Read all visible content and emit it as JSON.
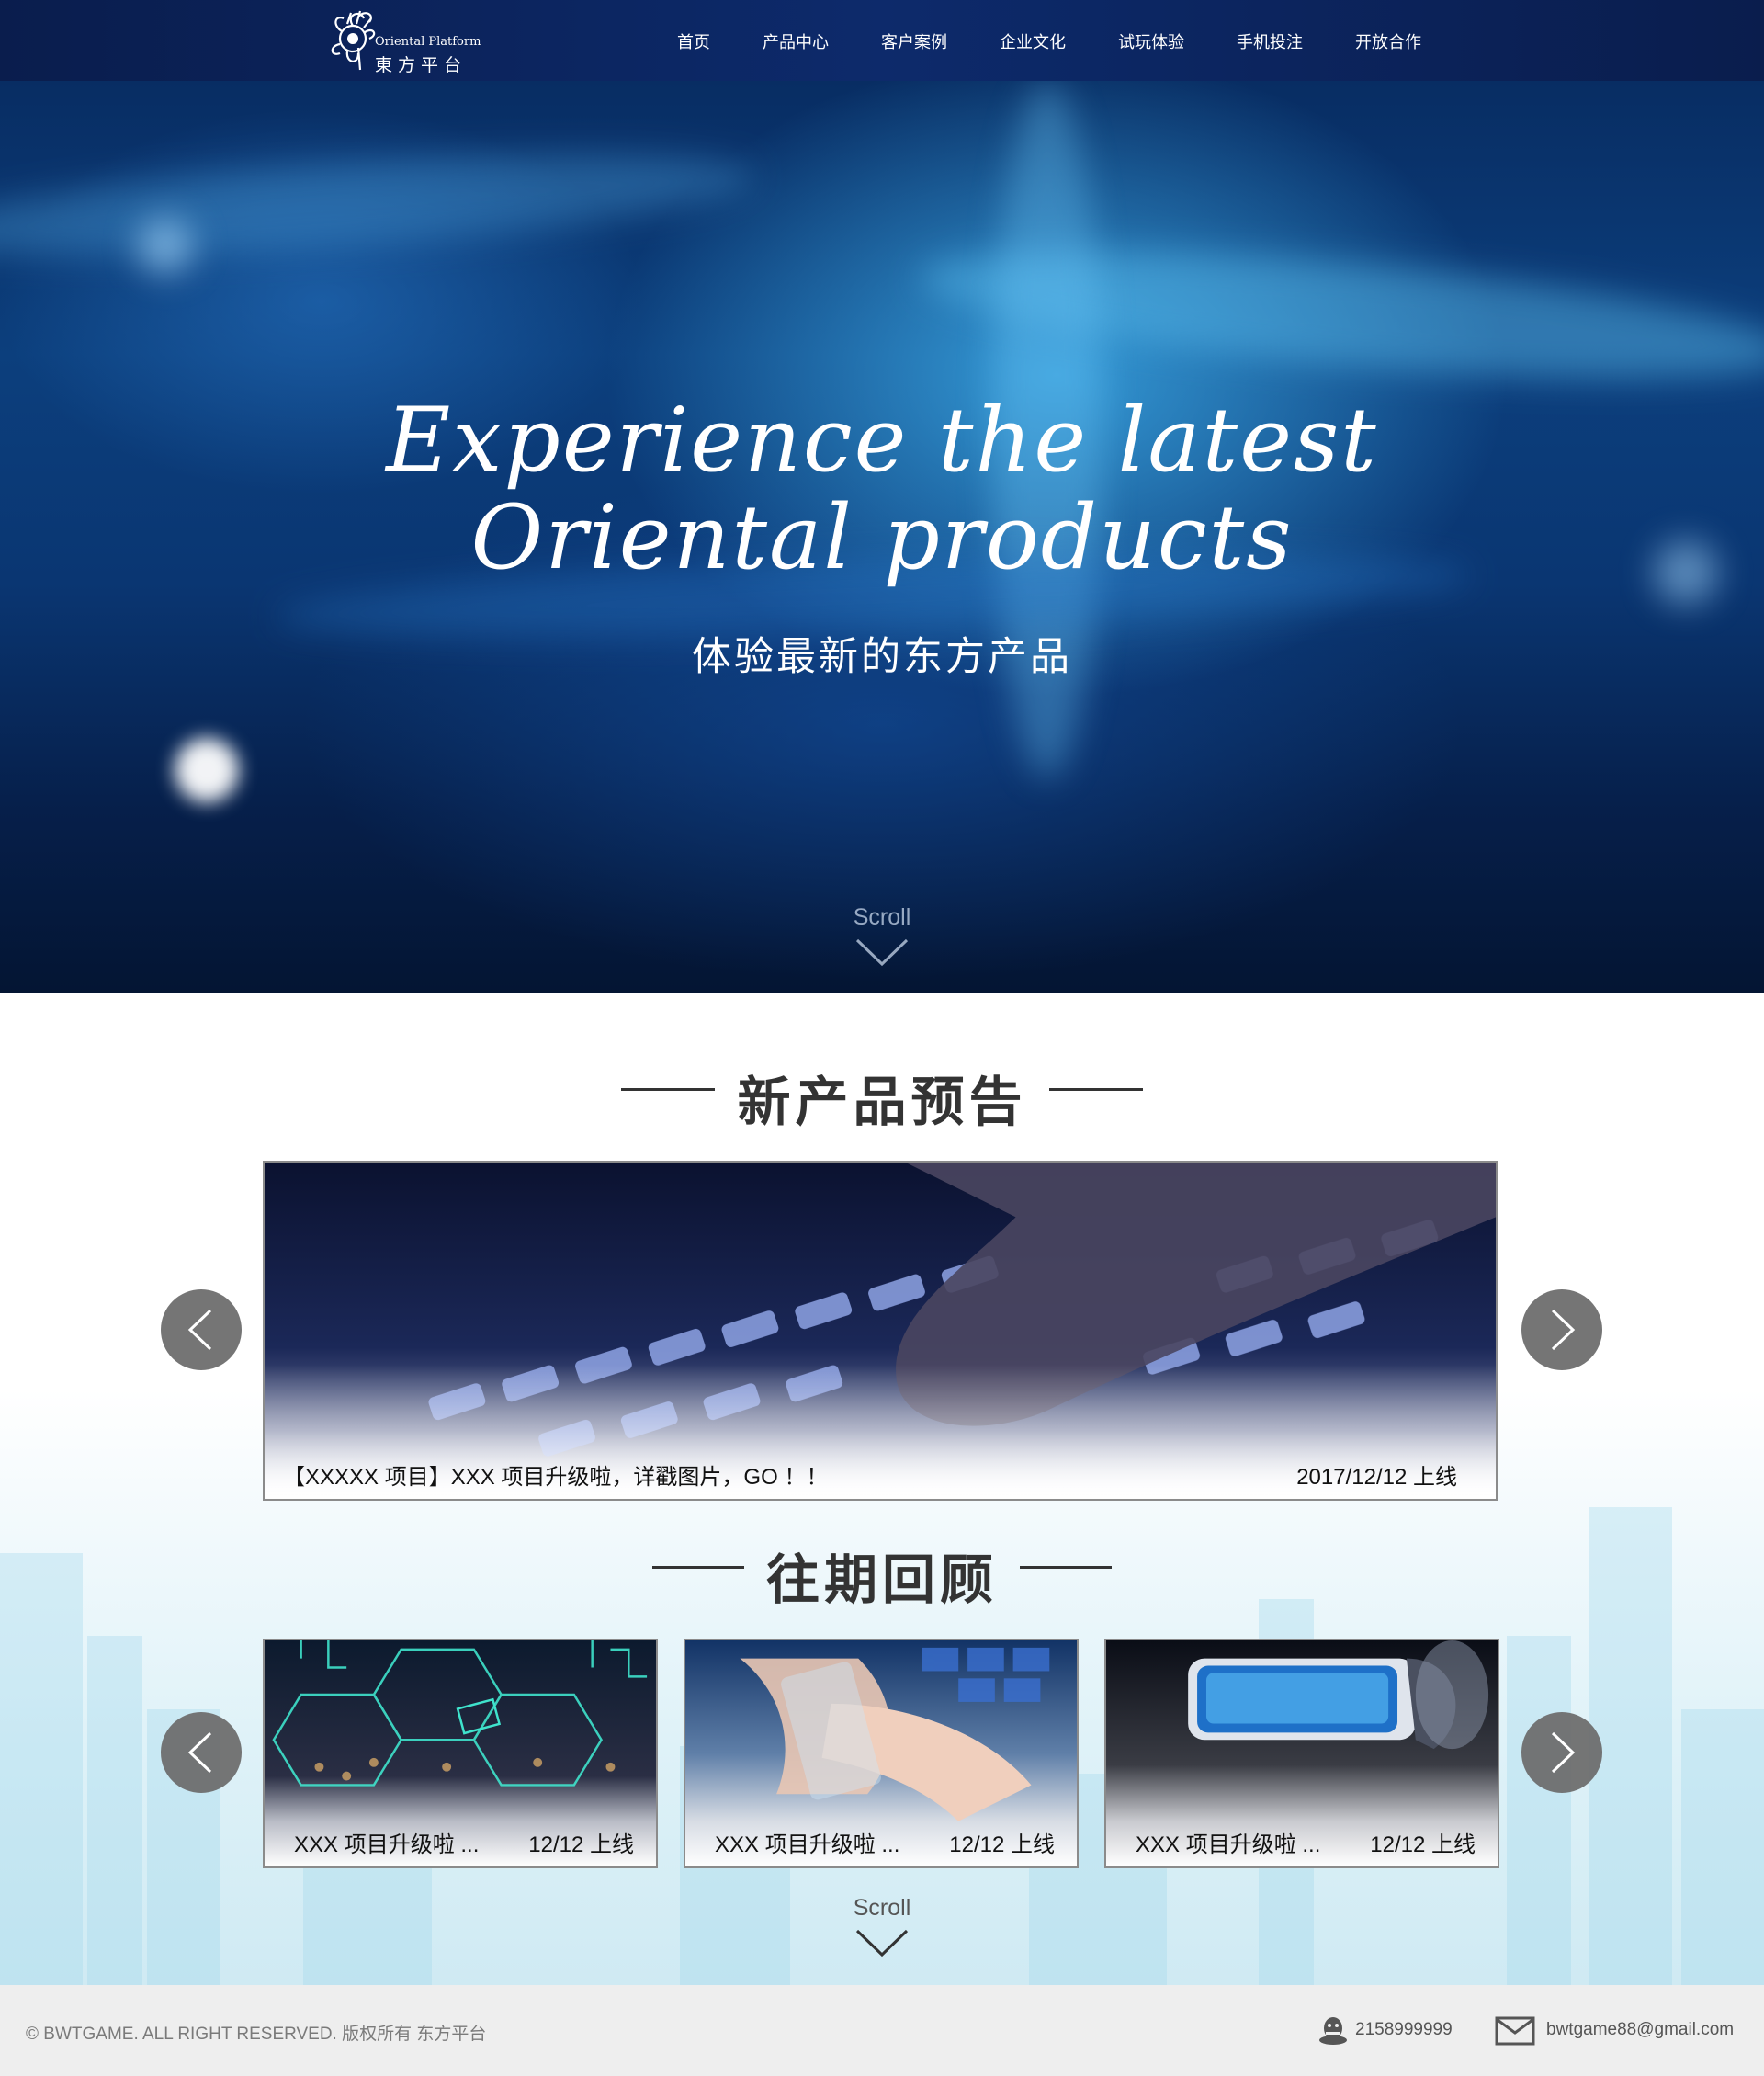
{
  "header": {
    "logo_en": "Oriental Platform",
    "logo_cn": "東方平台",
    "nav": [
      {
        "label": "首页"
      },
      {
        "label": "产品中心"
      },
      {
        "label": "客户案例"
      },
      {
        "label": "企业文化"
      },
      {
        "label": "试玩体验"
      },
      {
        "label": "手机投注"
      },
      {
        "label": "开放合作"
      }
    ]
  },
  "hero": {
    "title_line1": "Experience the latest",
    "title_line2": "Oriental products",
    "subtitle": "体验最新的东方产品",
    "scroll_label": "Scroll"
  },
  "new_products": {
    "title": "新产品预告",
    "feature": {
      "caption": "【XXXXX 项目】XXX 项目升级啦，详戳图片，GO ！！",
      "date": "2017/12/12 上线"
    }
  },
  "past": {
    "title": "往期回顾",
    "cards": [
      {
        "caption": "XXX 项目升级啦 ...",
        "date": "12/12 上线"
      },
      {
        "caption": "XXX 项目升级啦 ...",
        "date": "12/12 上线"
      },
      {
        "caption": "XXX 项目升级啦 ...",
        "date": "12/12 上线"
      }
    ],
    "scroll_label": "Scroll"
  },
  "footer": {
    "copyright": "© BWTGAME. ALL RIGHT RESERVED. 版权所有 东方平台",
    "qq": "2158999999",
    "email": "bwtgame88@gmail.com"
  },
  "colors": {
    "header_bg": "#0a1d4d",
    "hero_blue": "#0c3f7d",
    "title_text": "#333333",
    "arrow_button": "#6e6e6e",
    "footer_bg": "#eeeeee"
  }
}
